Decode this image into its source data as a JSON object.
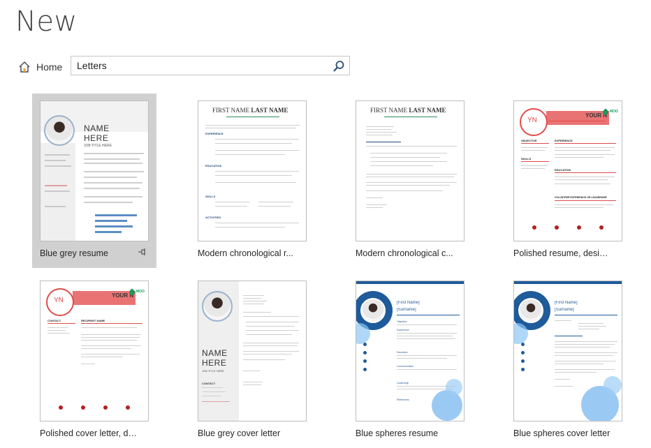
{
  "page": {
    "title": "New"
  },
  "nav": {
    "home_label": "Home",
    "home_icon": "home-icon"
  },
  "search": {
    "value": "Letters",
    "icon": "search-icon"
  },
  "templates": [
    {
      "label": "Blue grey resume",
      "selected": true,
      "thumb": {
        "name_line1": "NAME",
        "name_line2": "HERE",
        "job_title": "JOB TITLE HERE"
      }
    },
    {
      "label": "Modern chronological r...",
      "thumb": {
        "first": "FIRST NAME",
        "last": "LAST NAME",
        "section1": "EXPERIENCE",
        "section2": "EDUCATION",
        "section3": "SKILLS",
        "section4": "ACTIVITIES"
      }
    },
    {
      "label": "Modern chronological c...",
      "thumb": {
        "first": "FIRST NAME",
        "last": "LAST NAME"
      }
    },
    {
      "label": "Polished resume, desig...",
      "thumb": {
        "initials": "YN",
        "your_name": "YOUR N",
        "moo": "MOO",
        "s1": "OBJECTIVE",
        "s2": "EXPERIENCE",
        "s3": "SKILLS",
        "s4": "EDUCATION",
        "s5": "VOLUNTEER EXPERIENCE OR LEADERSHIP"
      }
    },
    {
      "label": "Polished cover letter, de...",
      "thumb": {
        "initials": "YN",
        "your_name": "YOUR N",
        "moo": "MOO",
        "contact": "CONTACT",
        "recipient": "RECIPIENT NAME"
      }
    },
    {
      "label": "Blue grey cover letter",
      "thumb": {
        "name_line1": "NAME",
        "name_line2": "HERE",
        "job_title": "JOB TITLE HERE",
        "contact": "CONTACT"
      }
    },
    {
      "label": "Blue spheres resume",
      "thumb": {
        "first": "[First Name]",
        "surname": "[Surname]",
        "s1": "Objective",
        "s2": "Experience",
        "s3": "Education",
        "s4": "Communication",
        "s5": "Leadership",
        "s6": "References"
      }
    },
    {
      "label": "Blue spheres cover letter",
      "thumb": {
        "first": "[First Name]",
        "surname": "[Surname]"
      }
    }
  ],
  "colors": {
    "accent_red": "#e24b4b",
    "accent_blue": "#1f5b9b",
    "sphere_blue": "#6fb4ef",
    "selected_bg": "#d0d0d0"
  }
}
